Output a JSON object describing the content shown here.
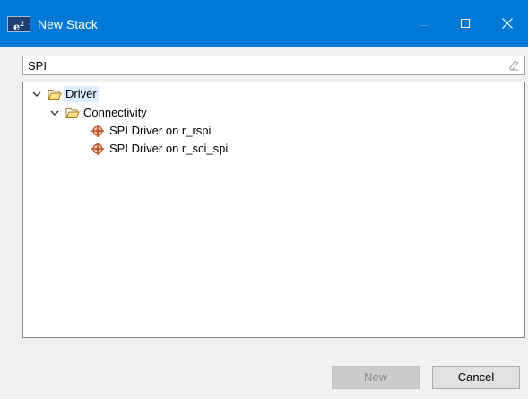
{
  "window": {
    "title": "New Stack",
    "app_icon_text": "e",
    "app_icon_sup": "2",
    "controls": [
      "minimize-icon",
      "maximize-icon",
      "close-icon"
    ]
  },
  "search": {
    "value": "SPI",
    "placeholder": "",
    "clear_icon": "clear-eraser-icon"
  },
  "tree": {
    "driver": {
      "label": "Driver",
      "icon": "folder-open-icon",
      "expanded": true,
      "selected": true
    },
    "connectivity": {
      "label": "Connectivity",
      "icon": "folder-open-icon",
      "expanded": true
    },
    "items": [
      {
        "label": "SPI Driver on r_rspi",
        "icon": "module-component-icon"
      },
      {
        "label": "SPI Driver on r_sci_spi",
        "icon": "module-component-icon"
      }
    ]
  },
  "buttons": {
    "new": "New",
    "cancel": "Cancel"
  },
  "colors": {
    "titlebar": "#0078d7",
    "selection": "#dceeff",
    "folder": "#e3a935",
    "component": "#c8643c"
  }
}
